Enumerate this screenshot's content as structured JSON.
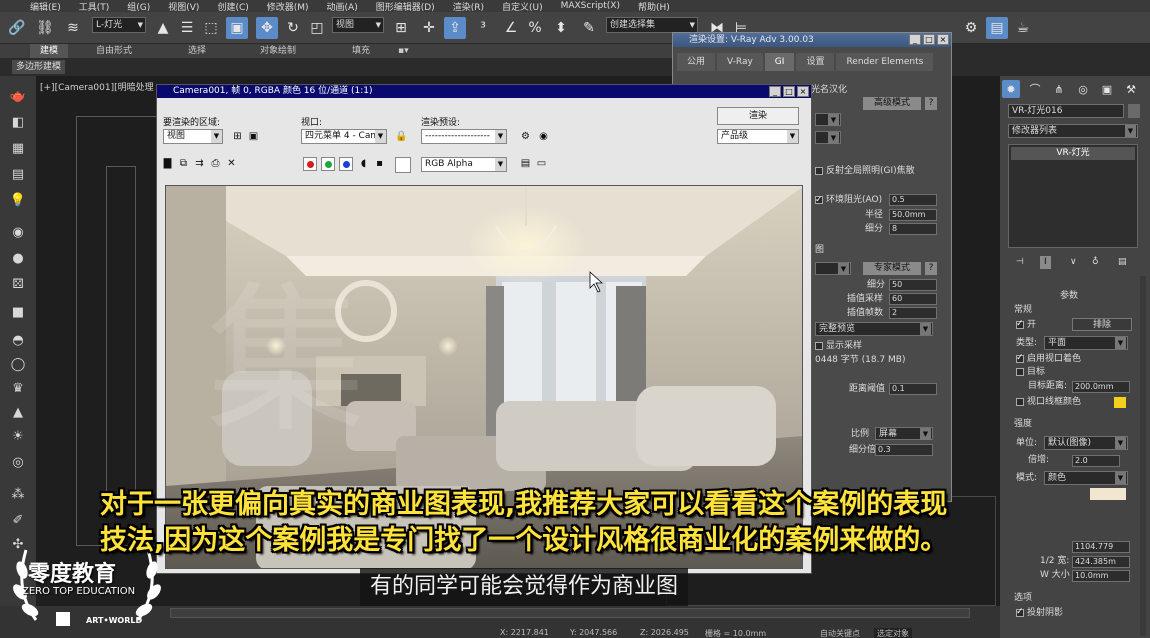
{
  "menubar": {
    "items": [
      "编辑(E)",
      "工具(T)",
      "组(G)",
      "视图(V)",
      "创建(C)",
      "修改器(M)",
      "动画(A)",
      "图形编辑器(D)",
      "渲染(R)",
      "自定义(U)",
      "MAXScript(X)",
      "帮助(H)"
    ]
  },
  "toolbar": {
    "selection_filter": "L-灯光",
    "reference_coord": "视图",
    "named_selection": "创建选择集",
    "colors": {
      "active": "#5c8cc7"
    }
  },
  "ribbon": {
    "tabs": [
      "建模",
      "自由形式",
      "选择",
      "对象绘制",
      "填充"
    ],
    "subtab": "多边形建模"
  },
  "viewport": {
    "label": "[+][Camera001][明暗处理"
  },
  "render_setup": {
    "title": "渲染设置: V-Ray Adv 3.00.03",
    "tabs": [
      "公用",
      "V-Ray",
      "GI",
      "设置",
      "Render Elements"
    ],
    "selected_tab": "GI",
    "localize_label": "光名汉化",
    "advanced_mode": "高级模式",
    "question": "?",
    "reflective_caustics": "反射全局照明(GI)焦散",
    "ambient_occlusion": "环境阻光(AO)",
    "ao_amount": "0.5",
    "radius_label": "半径",
    "radius_value": "50.0mm",
    "subdivs_label": "细分",
    "subdivs_value": "8",
    "section_map": "图",
    "expert_mode": "专家模式",
    "subdivs2_label": "细分",
    "subdivs2_value": "50",
    "interp_samples_label": "插值采样",
    "interp_samples_value": "60",
    "interp_frames_label": "插值帧数",
    "interp_frames_value": "2",
    "preview_mode": "完整预览",
    "show_samples": "显示采样",
    "memory": "0448 字节 (18.7 MB)",
    "distance_threshold_label": "距离阈值",
    "distance_threshold_value": "0.1",
    "scale_label": "比例",
    "scale_value": "屏幕",
    "subdiv_mult_label": "细分倍增",
    "subdiv_mult_value": "0.3"
  },
  "frame_buffer": {
    "title": "Camera001, 帧 0, RGBA 颜色 16 位/通道 (1:1)",
    "area_label": "要渲染的区域:",
    "area_value": "视图",
    "viewport_label": "视口:",
    "viewport_value": "四元菜单 4 - Cam",
    "preset_label": "渲染预设:",
    "preset_value": "--------------------",
    "render_button": "渲染",
    "quality_value": "产品级",
    "channel_value": "RGB Alpha",
    "watermark": "集",
    "colors": {
      "title_bar": "#0a0a6e",
      "red": "#d81b1b",
      "green": "#1aa83a",
      "blue": "#1b3fd8"
    }
  },
  "command_panel": {
    "object_name": "VR-灯光016",
    "modifier_list": "修改器列表",
    "stack_item": "VR-灯光",
    "rollout_params": "参数",
    "general": "常规",
    "on_label": "开",
    "exclude_button": "排除",
    "type_label": "类型:",
    "type_value": "平面",
    "enable_viewport_shading": "启用视口着色",
    "target": "目标",
    "target_distance_label": "目标距离:",
    "target_distance_value": "200.0mm",
    "viewport_wire_color": "视口线框颜色",
    "wire_color": "#f2d21a",
    "intensity": "强度",
    "units_label": "单位:",
    "units_value": "默认(图像)",
    "multiplier_label": "倍增:",
    "multiplier_value": "2.0",
    "mode_label": "模式:",
    "mode_value": "颜色",
    "half_length_value": "1104.779",
    "half_width_label": "1/2 宽:",
    "half_width_value": "424.385m",
    "w_size_label": "W 大小",
    "w_size_value": "10.0mm",
    "options": "选项",
    "cast_shadows": "投射阴影"
  },
  "bottom": {
    "coords": [
      "X: 2217.841",
      "Y: 2047.566",
      "Z: 2026.495"
    ],
    "grid": "栅格 = 10.0mm",
    "key_mode": "自动关键点",
    "selection": "选定对象"
  },
  "subtitles": {
    "line1": "对于一张更偏向真实的商业图表现,我推荐大家可以看看这个案例的表现",
    "line2": "技法,因为这个案例我是专门找了一个设计风格很商业化的案例来做的。",
    "secondary": "有的同学可能会觉得作为商业图"
  },
  "logo": {
    "title": "零度教育",
    "subtitle": "ZERO TOP EDUCATION",
    "brand": "ART•WORLD"
  }
}
